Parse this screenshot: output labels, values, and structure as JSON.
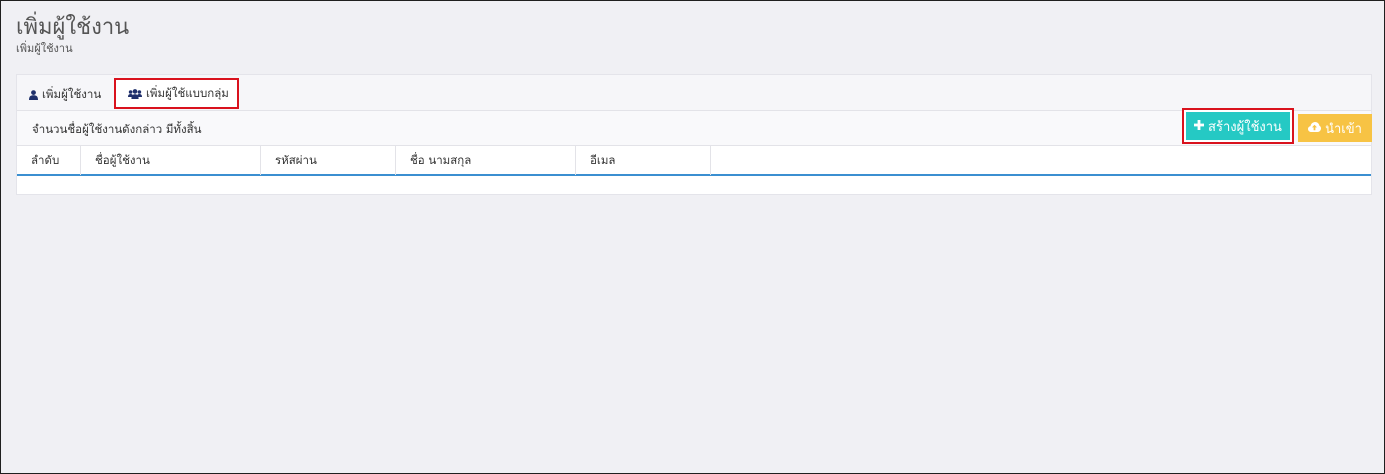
{
  "page": {
    "title": "เพิ่มผู้ใช้งาน",
    "subtitle": "เพิ่มผู้ใช้งาน"
  },
  "tabs": [
    {
      "label": "เพิ่มผู้ใช้งาน",
      "icon": "user-icon"
    },
    {
      "label": "เพิ่มผู้ใช้แบบกลุ่ม",
      "icon": "users-icon"
    }
  ],
  "toolbar": {
    "count_label": "จำนวนชื่อผู้ใช้งานดังกล่าว มีทั้งสิ้น",
    "create_label": "สร้างผู้ใช้งาน",
    "import_label": "นำเข้า"
  },
  "table": {
    "columns": [
      "ลำดับ",
      "ชื่อผู้ใช้งาน",
      "รหัสผ่าน",
      "ชื่อ นามสกุล",
      "อีเมล"
    ],
    "rows": []
  },
  "colors": {
    "create_button": "#25c9c4",
    "import_button": "#f7c344",
    "highlight_border": "#d9121d",
    "table_header_underline": "#3b8fd1",
    "icon_navy": "#1e2f6b"
  }
}
